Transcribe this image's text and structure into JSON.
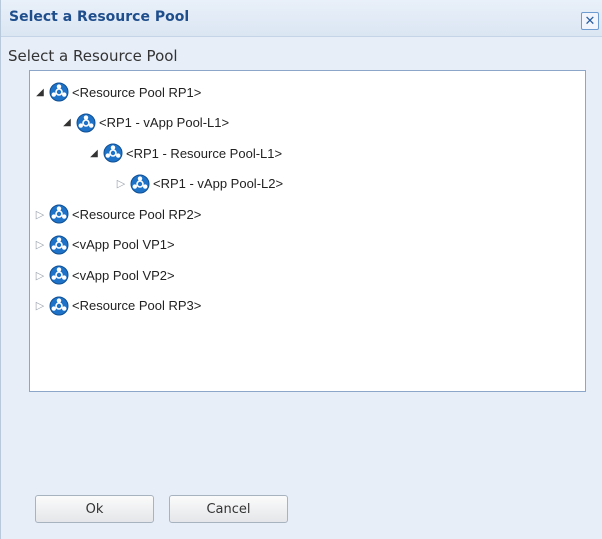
{
  "dialog": {
    "title": "Select a Resource Pool",
    "close_label": "✕",
    "subtitle": "Select a Resource Pool"
  },
  "tree": {
    "nodes": [
      {
        "label": "<Resource Pool RP1>",
        "level": 0,
        "expanded": true
      },
      {
        "label": "<RP1 - vApp Pool-L1>",
        "level": 1,
        "expanded": true
      },
      {
        "label": "<RP1 - Resource Pool-L1>",
        "level": 2,
        "expanded": true
      },
      {
        "label": "<RP1 - vApp Pool-L2>",
        "level": 3,
        "expanded": false
      },
      {
        "label": "<Resource Pool RP2>",
        "level": 0,
        "expanded": false
      },
      {
        "label": "<vApp Pool VP1>",
        "level": 0,
        "expanded": false
      },
      {
        "label": "<vApp Pool VP2>",
        "level": 0,
        "expanded": false
      },
      {
        "label": "<Resource Pool RP3>",
        "level": 0,
        "expanded": false
      }
    ]
  },
  "buttons": {
    "ok_label": "Ok",
    "cancel_label": "Cancel"
  },
  "icons": {
    "pool": "resource-pool-icon",
    "expanded": "expanded-arrow-icon",
    "collapsed": "collapsed-arrow-icon",
    "close": "close-icon"
  },
  "colors": {
    "title": "#1f4e8c",
    "icon": "#1e73c8",
    "panel_bg": "#e7eef7"
  }
}
